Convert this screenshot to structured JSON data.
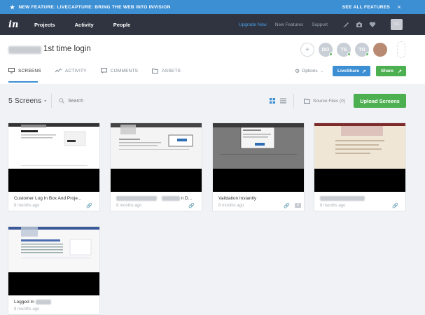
{
  "announcement": {
    "text": "NEW FEATURE: LIVECAPTURE: BRING THE WEB INTO INVISION",
    "see_all": "SEE ALL FEATURES",
    "close": "×"
  },
  "nav": {
    "logo": "in",
    "primary": [
      "Projects",
      "Activity",
      "People"
    ],
    "secondary": [
      "Upgrade Now",
      "New Features",
      "Support"
    ],
    "user_initials": "SS"
  },
  "project": {
    "title": "1st time login"
  },
  "members": [
    "+",
    "DO",
    "TS",
    "TO"
  ],
  "tabs": [
    "SCREENS",
    "ACTIVITY",
    "COMMENTS",
    "ASSETS"
  ],
  "header_actions": {
    "options": "Options",
    "liveshare": "LiveShare",
    "share": "Share"
  },
  "toolbar": {
    "count": "5 Screens",
    "search_placeholder": "Search",
    "source_files": "Source Files (0)",
    "upload": "Upload Screens"
  },
  "screens": [
    {
      "name": "Customer Log In Box And Proje...",
      "ago": "8 months ago"
    },
    {
      "name": "n D...",
      "ago": "8 months ago"
    },
    {
      "name": "Validation Instantly",
      "ago": "8 months ago",
      "comments": "0"
    },
    {
      "name": "",
      "ago": "8 months ago"
    },
    {
      "name": "Logged In",
      "ago": "8 months ago"
    }
  ],
  "colors": {
    "accent_blue": "#3d8fd4",
    "nav_dark": "#2f3440",
    "green": "#4caf50"
  }
}
